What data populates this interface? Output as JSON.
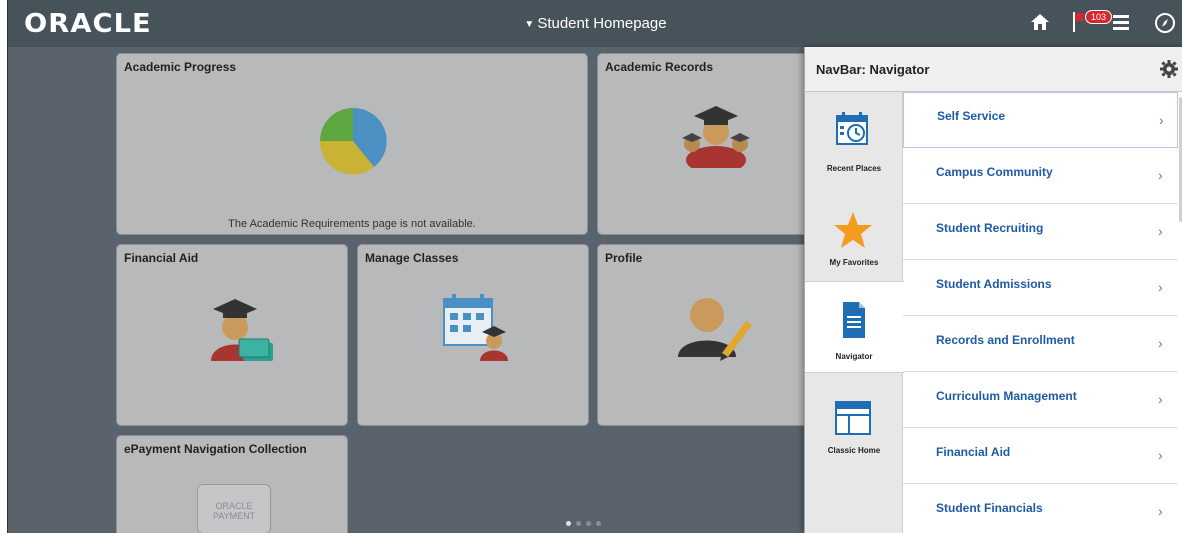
{
  "header": {
    "logo": "ORACLE",
    "title": "Student Homepage",
    "title_caret": "▼",
    "notification_count": "103"
  },
  "tiles": {
    "academic_progress": {
      "title": "Academic Progress",
      "message": "The Academic Requirements page is not available."
    },
    "academic_records": {
      "title": "Academic Records"
    },
    "financial_aid": {
      "title": "Financial Aid"
    },
    "manage_classes": {
      "title": "Manage Classes"
    },
    "profile": {
      "title": "Profile"
    },
    "epayment": {
      "title": "ePayment Navigation Collection",
      "logo_line1": "ORACLE",
      "logo_line2": "PAYMENT"
    }
  },
  "pager": {
    "pages": 4,
    "active": 1
  },
  "navbar": {
    "title": "NavBar: Navigator",
    "tabs": [
      {
        "label": "Recent Places",
        "icon": "recent-places-icon"
      },
      {
        "label": "My Favorites",
        "icon": "star-icon"
      },
      {
        "label": "Navigator",
        "icon": "document-icon"
      },
      {
        "label": "Classic Home",
        "icon": "classic-home-icon"
      }
    ],
    "active_tab": "Navigator",
    "items": [
      {
        "label": "Self Service"
      },
      {
        "label": "Campus Community"
      },
      {
        "label": "Student Recruiting"
      },
      {
        "label": "Student Admissions"
      },
      {
        "label": "Records and Enrollment"
      },
      {
        "label": "Curriculum Management"
      },
      {
        "label": "Financial Aid"
      },
      {
        "label": "Student Financials"
      }
    ],
    "chevron": "›"
  },
  "colors": {
    "header_bg": "#47535a",
    "page_bg": "#5a636b",
    "tile_bg": "#b7b9bb",
    "link_blue": "#1f5aa6",
    "badge_red": "#d8262d",
    "favorite_star": "#f39c1f"
  }
}
